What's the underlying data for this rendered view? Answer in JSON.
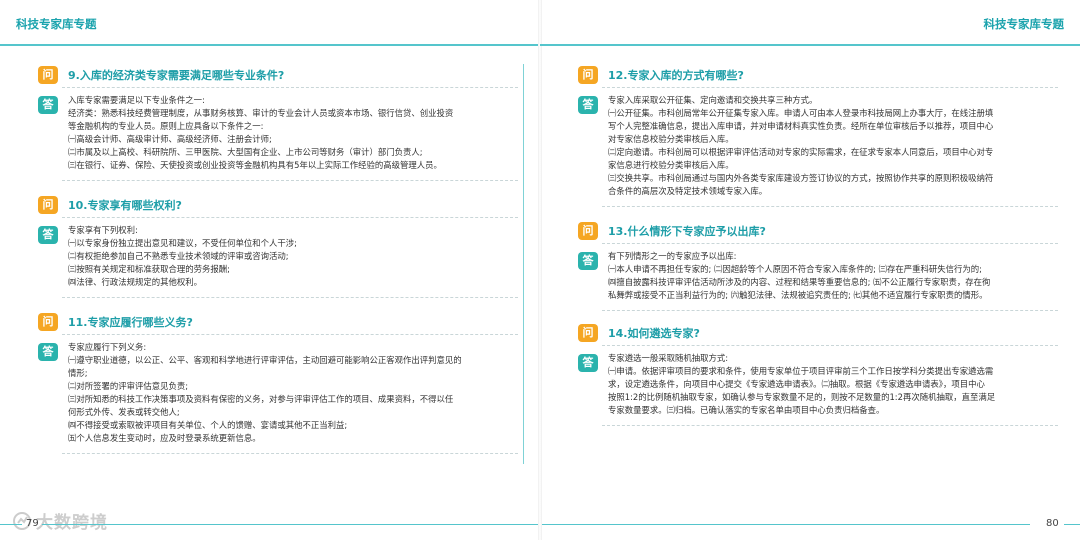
{
  "header": {
    "left_title": "科技专家库专题",
    "right_title": "科技专家库专题"
  },
  "footer": {
    "left_page": "79",
    "right_page": "80",
    "watermark": "大数跨境"
  },
  "badges": {
    "question": "问",
    "answer": "答"
  },
  "left_qa": [
    {
      "question": "9.入库的经济类专家需要满足哪些专业条件?",
      "answer_lines": [
        "入库专家需要满足以下专业条件之一:",
        "经济类：熟悉科技经费管理制度，从事财务核算、审计的专业会计人员或资本市场、银行信贷、创业投资",
        "等金融机构的专业人员。原则上应具备以下条件之一:",
        "㈠高级会计师、高级审计师、高级经济师、注册会计师;",
        "㈡市属及以上高校、科研院所、三甲医院、大型国有企业、上市公司等财务（审计）部门负责人;",
        "㈢在银行、证券、保险、天使投资或创业投资等金融机构具有5年以上实际工作经验的高级管理人员。"
      ]
    },
    {
      "question": "10.专家享有哪些权利?",
      "answer_lines": [
        "专家享有下列权利:",
        "㈠以专家身份独立提出意见和建议，不受任何单位和个人干涉;",
        "㈡有权拒绝参加自己不熟悉专业技术领域的评审或咨询活动;",
        "㈢按照有关规定和标准获取合理的劳务报酬;",
        "㈣法律、行政法规规定的其他权利。"
      ]
    },
    {
      "question": "11.专家应履行哪些义务?",
      "answer_lines": [
        "专家应履行下列义务:",
        "㈠遵守职业道德，以公正、公平、客观和科学地进行评审评估，主动回避可能影响公正客观作出评判意见的",
        "情形;",
        "㈡对所签署的评审评估意见负责;",
        "㈢对所知悉的科技工作决策事项及资料有保密的义务，对参与评审评估工作的项目、成果资料，不得以任",
        "何形式外传、发表或转交他人;",
        "㈣不得接受或索取被评项目有关单位、个人的馈赠、宴请或其他不正当利益;",
        "㈤个人信息发生变动时，应及时登录系统更新信息。"
      ]
    }
  ],
  "right_qa": [
    {
      "question": "12.专家入库的方式有哪些?",
      "answer_lines": [
        "专家入库采取公开征集、定向邀请和交换共享三种方式。",
        "㈠公开征集。市科创局常年公开征集专家入库。申请人可由本人登录市科技局网上办事大厅，在线注册填",
        "写个人完整准确信息，提出入库申请，并对申请材料真实性负责。经所在单位审核后予以推荐，项目中心",
        "对专家信息校验分类审核后入库。",
        "㈡定向邀请。市科创局可以根据评审评估活动对专家的实际需求，在征求专家本人同意后，项目中心对专",
        "家信息进行校验分类审核后入库。",
        "㈢交换共享。市科创局通过与国内外各类专家库建设方签订协议的方式，按照协作共享的原则积极吸纳符",
        "合条件的高层次及特定技术领域专家入库。"
      ]
    },
    {
      "question": "13.什么情形下专家应予以出库?",
      "answer_lines": [
        "有下列情形之一的专家应予以出库:",
        "㈠本人申请不再担任专家的; ㈡因超龄等个人原因不符合专家入库条件的; ㈢存在严重科研失信行为的;",
        "㈣擅自披露科技评审评估活动所涉及的内容、过程和结果等重要信息的; ㈤不公正履行专家职责，存在徇",
        "私舞弊或接受不正当利益行为的; ㈥触犯法律、法规被追究责任的; ㈦其他不适宜履行专家职责的情形。"
      ]
    },
    {
      "question": "14.如何遴选专家?",
      "answer_lines": [
        "专家遴选一般采取随机抽取方式:",
        "㈠申请。依据评审项目的要求和条件，使用专家单位于项目评审前三个工作日按学科分类提出专家遴选需",
        "求，设定遴选条件，向项目中心提交《专家遴选申请表》。㈡抽取。根据《专家遴选申请表》，项目中心",
        "按照1:2的比例随机抽取专家，如确认参与专家数量不足的，则按不足数量的1:2再次随机抽取，直至满足",
        "专家数量要求。㈢归档。已确认落实的专家名单由项目中心负责归档备查。"
      ]
    }
  ]
}
